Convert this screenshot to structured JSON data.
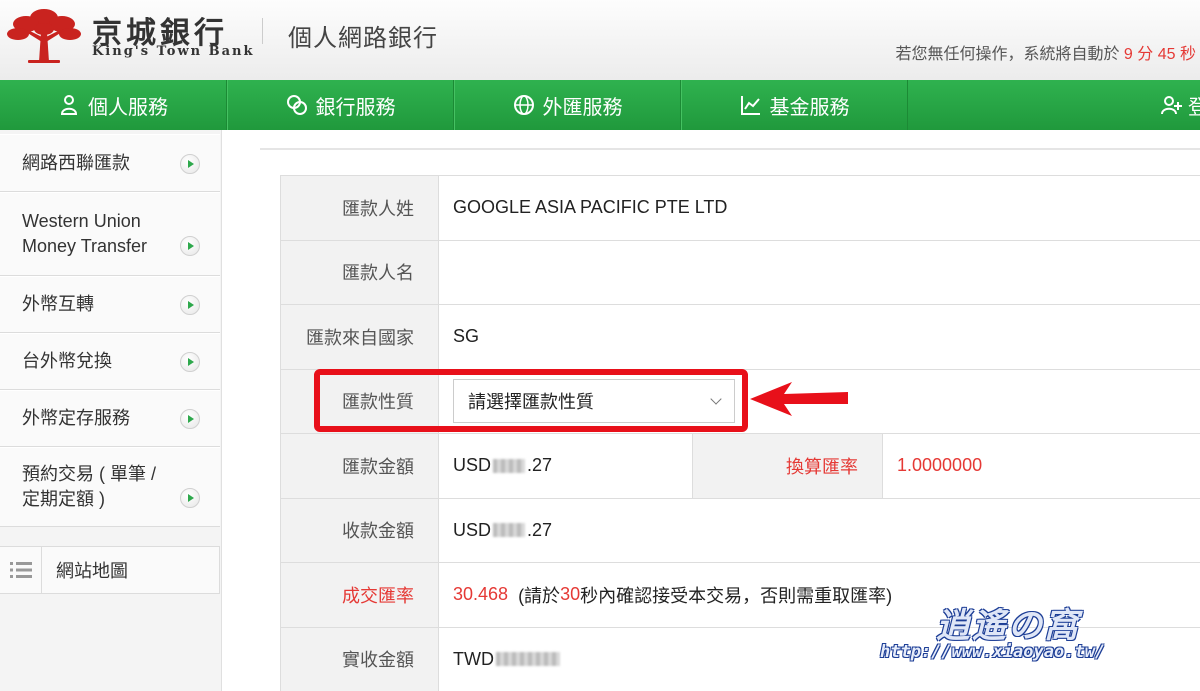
{
  "header": {
    "logo_cn": "京城銀行",
    "logo_en": "King's Town Bank",
    "site_title": "個人網路銀行",
    "timeout_prefix": "若您無任何操作，系統將自動於",
    "timeout_min": "9",
    "timeout_min_unit": "分",
    "timeout_sec": "45",
    "timeout_sec_unit": "秒"
  },
  "nav": {
    "items": [
      {
        "label": "個人服務",
        "icon": "person-icon"
      },
      {
        "label": "銀行服務",
        "icon": "coins-icon"
      },
      {
        "label": "外匯服務",
        "icon": "globe-icon"
      },
      {
        "label": "基金服務",
        "icon": "chart-icon"
      }
    ],
    "login_label": "登"
  },
  "sidebar": {
    "items": [
      {
        "label": "網路西聯匯款"
      },
      {
        "label": "Western Union Money Transfer"
      },
      {
        "label": "外幣互轉"
      },
      {
        "label": "台外幣兌換"
      },
      {
        "label": "外幣定存服務"
      },
      {
        "label": "預約交易 ( 單筆 / 定期定額 )"
      }
    ],
    "sitemap_label": "網站地圖"
  },
  "form": {
    "sender_surname_label": "匯款人姓",
    "sender_surname": "GOOGLE ASIA PACIFIC PTE LTD",
    "sender_name_label": "匯款人名",
    "sender_name": "",
    "country_label": "匯款來自國家",
    "country": "SG",
    "nature_label": "匯款性質",
    "nature_placeholder": "請選擇匯款性質",
    "amount_label": "匯款金額",
    "amount_currency": "USD",
    "amount_suffix": ".27",
    "conv_rate_label": "換算匯率",
    "conv_rate": "1.0000000",
    "received_label": "收款金額",
    "received_currency": "USD",
    "received_suffix": ".27",
    "deal_rate_label": "成交匯率",
    "deal_rate": "30.468",
    "deal_note_prefix": "(請於",
    "deal_note_seconds": "30",
    "deal_note_suffix": "秒內確認接受本交易，否則需重取匯率)",
    "actual_label": "實收金額",
    "actual_currency": "TWD"
  },
  "watermark": {
    "cn": "逍遙の窩",
    "url": "http://www.xiaoyao.tw/"
  },
  "colors": {
    "brand_green": "#2aa84a",
    "alert_red": "#e53935",
    "highlight_red": "#e8101a"
  }
}
